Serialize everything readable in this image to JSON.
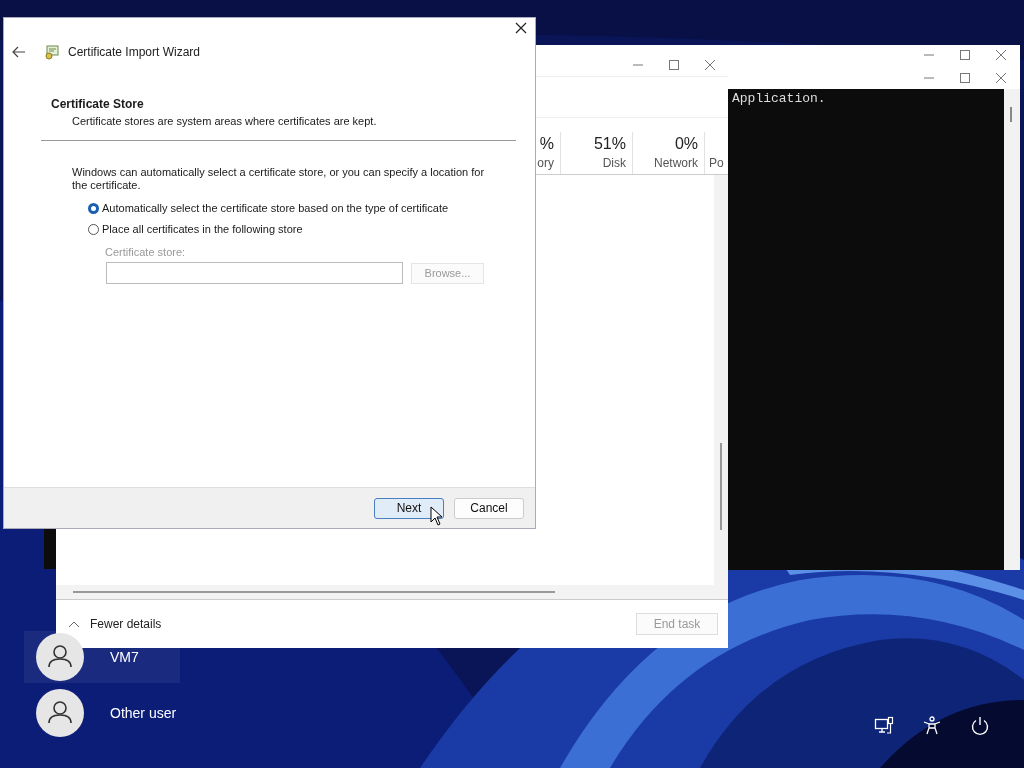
{
  "console": {
    "output": "Application."
  },
  "task_manager": {
    "columns": [
      {
        "value": "%",
        "label": "ory"
      },
      {
        "value": "51%",
        "label": "Disk"
      },
      {
        "value": "0%",
        "label": "Network"
      },
      {
        "label": "Po"
      }
    ],
    "details_toggle": "Fewer details",
    "end_task": {
      "label": "End task",
      "disabled": true
    }
  },
  "wizard": {
    "title": "Certificate Import Wizard",
    "heading": "Certificate Store",
    "description": "Certificate stores are system areas where certificates are kept.",
    "intro": "Windows can automatically select a certificate store, or you can specify a location for the certificate.",
    "options": [
      {
        "label": "Automatically select the certificate store based on the type of certificate",
        "selected": true
      },
      {
        "label": "Place all certificates in the following store",
        "selected": false
      }
    ],
    "store_field": {
      "label": "Certificate store:",
      "disabled": true
    },
    "browse": {
      "label": "Browse...",
      "disabled": true
    },
    "buttons": [
      {
        "label": "Next",
        "hovered": true
      },
      {
        "label": "Cancel",
        "hovered": false
      }
    ]
  },
  "users": [
    {
      "name": "VM7",
      "selected": true
    },
    {
      "name": "Other user",
      "selected": false
    }
  ]
}
